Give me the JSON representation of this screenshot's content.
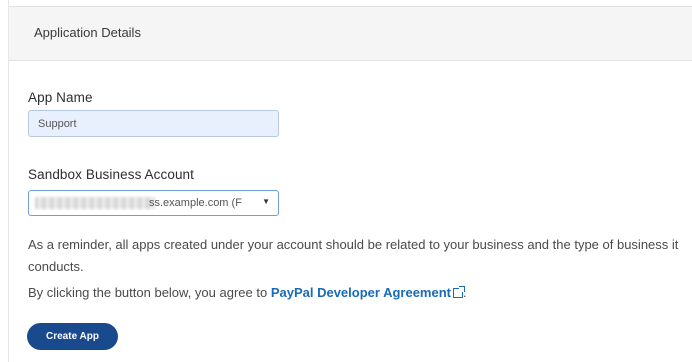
{
  "panel": {
    "title": "Application Details"
  },
  "app_name": {
    "label": "App Name",
    "value": "Support"
  },
  "sandbox": {
    "label": "Sandbox Business Account",
    "value_visible": "ss.example.com (F",
    "caret": "▼"
  },
  "text": {
    "reminder": "As a reminder, all apps created under your account should be related to your business and the type of business it conducts.",
    "agreement_prefix": "By clicking the button below, you agree to ",
    "agreement_link": "PayPal Developer Agreement",
    "agreement_suffix": "."
  },
  "actions": {
    "create_label": "Create App"
  },
  "colors": {
    "link": "#1a6bb5",
    "primary_button": "#1a4a8e",
    "input_fill": "#e8f0fe"
  },
  "icons": {
    "external_link": "external-link-icon",
    "dropdown": "chevron-down-icon"
  }
}
